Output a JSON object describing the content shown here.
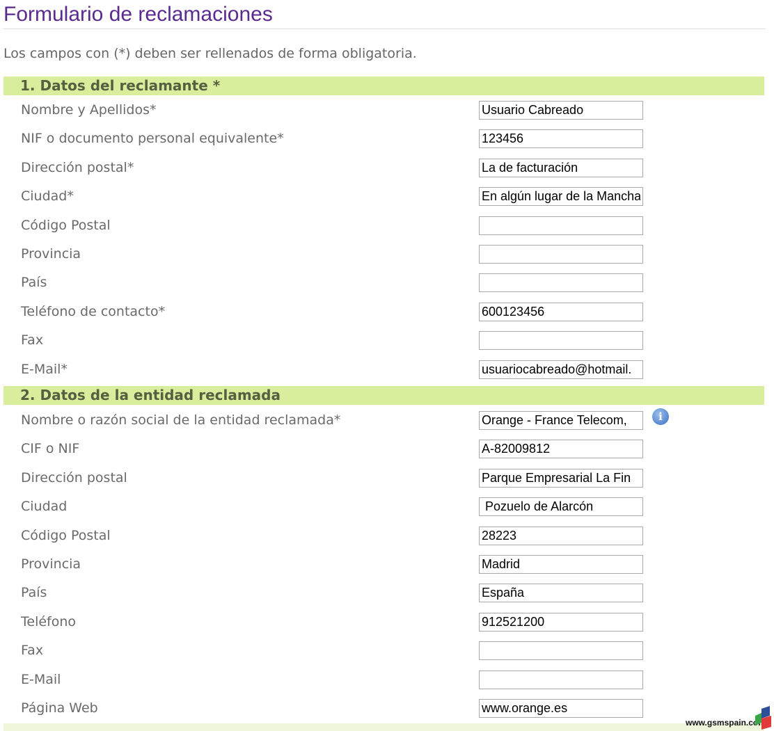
{
  "page": {
    "title": "Formulario de reclamaciones",
    "intro": "Los campos con (*) deben ser rellenados de forma obligatoria."
  },
  "sections": [
    {
      "heading": "1. Datos del reclamante *",
      "fields": [
        {
          "label": "Nombre y Apellidos*",
          "value": "Usuario Cabreado"
        },
        {
          "label": "NIF o documento personal equivalente*",
          "value": "123456"
        },
        {
          "label": "Dirección postal*",
          "value": "La de facturación"
        },
        {
          "label": "Ciudad*",
          "value": "En algún lugar de la Mancha"
        },
        {
          "label": "Código Postal",
          "value": ""
        },
        {
          "label": "Provincia",
          "value": ""
        },
        {
          "label": "País",
          "value": ""
        },
        {
          "label": "Teléfono de contacto*",
          "value": "600123456"
        },
        {
          "label": "Fax",
          "value": ""
        },
        {
          "label": "E-Mail*",
          "value": "usuariocabreado@hotmail."
        }
      ]
    },
    {
      "heading": "2. Datos de la entidad reclamada",
      "fields": [
        {
          "label": "Nombre o razón social de la entidad reclamada*",
          "value": "Orange - France Telecom,",
          "info_icon": "info-icon"
        },
        {
          "label": "CIF o NIF",
          "value": "A-82009812"
        },
        {
          "label": "Dirección postal",
          "value": "Parque Empresarial La Fin"
        },
        {
          "label": "Ciudad",
          "value": " Pozuelo de Alarcón"
        },
        {
          "label": "Código Postal",
          "value": "28223"
        },
        {
          "label": "Provincia",
          "value": "Madrid"
        },
        {
          "label": "País",
          "value": "España"
        },
        {
          "label": "Teléfono",
          "value": "912521200"
        },
        {
          "label": "Fax",
          "value": ""
        },
        {
          "label": "E-Mail",
          "value": ""
        },
        {
          "label": "Página Web",
          "value": "www.orange.es"
        }
      ]
    }
  ],
  "watermark": {
    "text": "www.gsmspain.com"
  },
  "colors": {
    "title": "#5b2a8f",
    "section_bar": "#d9ee9d",
    "section_text": "#556040",
    "label": "#6a6a6a"
  }
}
